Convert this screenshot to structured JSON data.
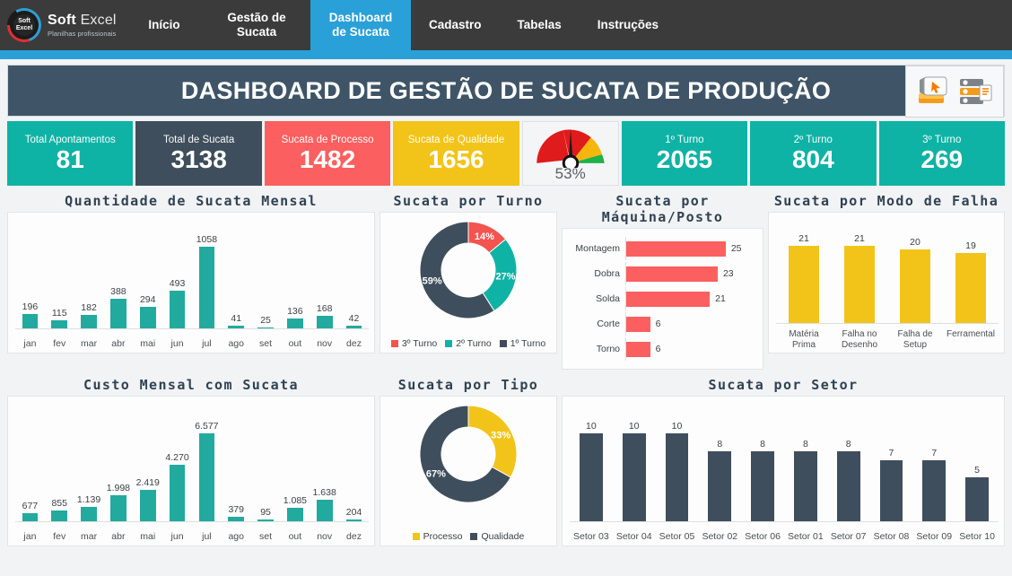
{
  "brand": {
    "logo_text_line1": "Soft",
    "logo_text_line2": "Excel",
    "name_bold": "Soft",
    "name_light": "Excel",
    "tagline": "Planilhas profissionais",
    "logo_icon": "gauge-ring-logo-icon"
  },
  "nav": {
    "items": [
      {
        "label": "Início",
        "active": false
      },
      {
        "label": "Gestão de Sucata",
        "active": false
      },
      {
        "label": "Dashboard de Sucata",
        "active": true
      },
      {
        "label": "Cadastro",
        "active": false
      },
      {
        "label": "Tabelas",
        "active": false
      },
      {
        "label": "Instruções",
        "active": false
      }
    ],
    "accent_color": "#2aa0d8",
    "bar_color": "#3b3b3b"
  },
  "header": {
    "title": "DASHBOARD DE GESTÃO DE SUCATA DE PRODUÇÃO",
    "background_color": "#3f5567",
    "icons": [
      {
        "name": "screen-cursor-icon",
        "label": "Apresentação"
      },
      {
        "name": "database-icon",
        "label": "Banco de Dados"
      }
    ]
  },
  "kpis": [
    {
      "label": "Total Apontamentos",
      "value": "81",
      "color": "#0fb3a5",
      "style": "teal"
    },
    {
      "label": "Total de Sucata",
      "value": "3138",
      "color": "#3f4e5c",
      "style": "dark"
    },
    {
      "label": "Sucata de Processo",
      "value": "1482",
      "color": "#fb5f5f",
      "style": "red"
    },
    {
      "label": "Sucata de Qualidade",
      "value": "1656",
      "color": "#f2c419",
      "style": "yellow"
    }
  ],
  "gauge": {
    "name": "performance-gauge",
    "value_label": "53%",
    "value": 53,
    "min": 0,
    "max": 100,
    "zones": [
      {
        "from": 0,
        "to": 62,
        "color": "#e01b1b"
      },
      {
        "from": 62,
        "to": 84,
        "color": "#f5b60d"
      },
      {
        "from": 84,
        "to": 100,
        "color": "#1eb24a"
      }
    ]
  },
  "shifts": [
    {
      "label": "1º Turno",
      "value": "2065",
      "color": "#0fb3a5"
    },
    {
      "label": "2º Turno",
      "value": "804",
      "color": "#0fb3a5"
    },
    {
      "label": "3º Turno",
      "value": "269",
      "color": "#0fb3a5"
    }
  ],
  "chart_data": [
    {
      "id": "quantidade-mensal",
      "type": "bar",
      "title": "Quantidade de Sucata Mensal",
      "categories": [
        "jan",
        "fev",
        "mar",
        "abr",
        "mai",
        "jun",
        "jul",
        "ago",
        "set",
        "out",
        "nov",
        "dez"
      ],
      "values": [
        196,
        115,
        182,
        388,
        294,
        493,
        1058,
        41,
        25,
        136,
        168,
        42
      ],
      "labels": [
        "196",
        "115",
        "182",
        "388",
        "294",
        "493",
        "1058",
        "41",
        "25",
        "136",
        "168",
        "42"
      ],
      "series_color": "#22aa9e",
      "xlabel": "",
      "ylabel": "",
      "ylim": [
        0,
        1058
      ],
      "grid": false,
      "legend": "none"
    },
    {
      "id": "sucata-por-turno",
      "type": "pie",
      "title": "Sucata por Turno",
      "categories": [
        "3º Turno",
        "2º Turno",
        "1º Turno"
      ],
      "values": [
        14,
        27,
        59
      ],
      "labels": [
        "14%",
        "27%",
        "59%"
      ],
      "colors": [
        "#f4544f",
        "#0fb3a5",
        "#3f4e5c"
      ],
      "legend": "bottom",
      "donut": true
    },
    {
      "id": "sucata-por-maquina",
      "type": "bar",
      "orientation": "horizontal",
      "title": "Sucata por Máquina/Posto",
      "categories": [
        "Montagem",
        "Dobra",
        "Solda",
        "Corte",
        "Torno"
      ],
      "values": [
        25,
        23,
        21,
        6,
        6
      ],
      "labels": [
        "25",
        "23",
        "21",
        "6",
        "6"
      ],
      "series_color": "#fb5f5f",
      "xlim": [
        0,
        27
      ],
      "grid": false,
      "legend": "none"
    },
    {
      "id": "sucata-modo-falha",
      "type": "bar",
      "title": "Sucata por Modo de Falha",
      "categories": [
        "Matéria Prima",
        "Falha no Desenho",
        "Falha de Setup",
        "Ferramental"
      ],
      "values": [
        21,
        21,
        20,
        19
      ],
      "labels": [
        "21",
        "21",
        "20",
        "19"
      ],
      "series_color": "#f2c419",
      "ylim": [
        0,
        22
      ],
      "grid": false,
      "legend": "none"
    },
    {
      "id": "custo-mensal",
      "type": "bar",
      "title": "Custo Mensal com Sucata",
      "categories": [
        "jan",
        "fev",
        "mar",
        "abr",
        "mai",
        "jun",
        "jul",
        "ago",
        "set",
        "out",
        "nov",
        "dez"
      ],
      "values": [
        677,
        855,
        1139,
        1998,
        2419,
        4270,
        6577,
        379,
        95,
        1085,
        1638,
        204
      ],
      "labels": [
        "677",
        "855",
        "1.139",
        "1.998",
        "2.419",
        "4.270",
        "6.577",
        "379",
        "95",
        "1.085",
        "1.638",
        "204"
      ],
      "series_color": "#22aa9e",
      "ylim": [
        0,
        6577
      ],
      "grid": false,
      "legend": "none"
    },
    {
      "id": "sucata-por-tipo",
      "type": "pie",
      "title": "Sucata por Tipo",
      "categories": [
        "Processo",
        "Qualidade"
      ],
      "values": [
        33,
        67
      ],
      "labels": [
        "33%",
        "67%"
      ],
      "colors": [
        "#f2c419",
        "#3f4e5c"
      ],
      "legend": "bottom",
      "donut": true
    },
    {
      "id": "sucata-por-setor",
      "type": "bar",
      "title": "Sucata por Setor",
      "categories": [
        "Setor 03",
        "Setor 04",
        "Setor 05",
        "Setor 02",
        "Setor 06",
        "Setor 01",
        "Setor 07",
        "Setor 08",
        "Setor 09",
        "Setor 10"
      ],
      "values": [
        10,
        10,
        10,
        8,
        8,
        8,
        8,
        7,
        7,
        5
      ],
      "labels": [
        "10",
        "10",
        "10",
        "8",
        "8",
        "8",
        "8",
        "7",
        "7",
        "5"
      ],
      "series_color": "#3f4e5c",
      "ylim": [
        0,
        11
      ],
      "grid": false,
      "legend": "none"
    }
  ]
}
